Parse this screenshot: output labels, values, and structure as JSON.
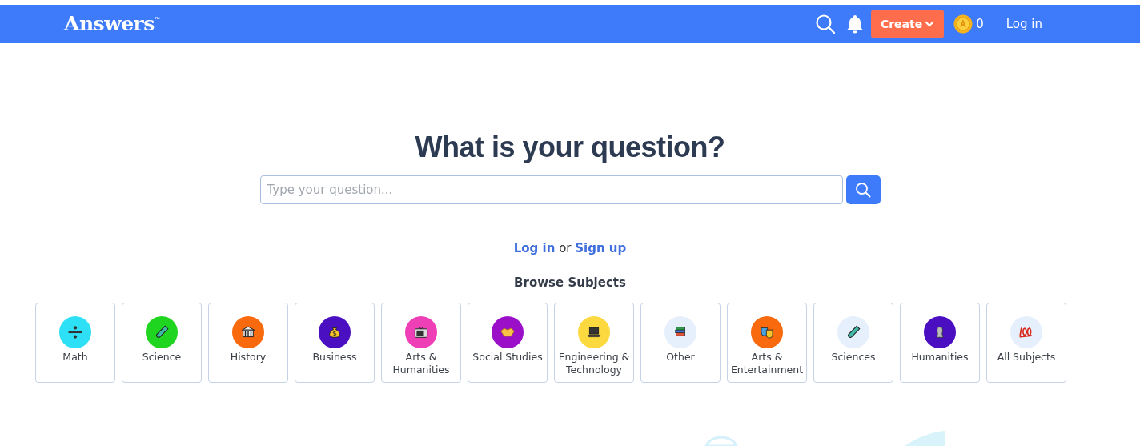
{
  "navbar": {
    "logo": "Answers",
    "logo_mark": "™",
    "create_button": "Create",
    "coins": "0",
    "login": "Log in"
  },
  "hero": {
    "title": "What is your question?",
    "search": {
      "placeholder": "Type your question..."
    }
  },
  "auth": {
    "login": "Log in",
    "or": "or",
    "signup": "Sign up"
  },
  "browse_title": "Browse Subjects",
  "subjects": [
    {
      "label": "Math",
      "color": "#2ee0f5"
    },
    {
      "label": "Science",
      "color": "#1fd51f"
    },
    {
      "label": "History",
      "color": "#f96a0e"
    },
    {
      "label": "Business",
      "color": "#4b0fc2"
    },
    {
      "label": "Arts & Humanities",
      "color": "#ee3fb6"
    },
    {
      "label": "Social Studies",
      "color": "#9b0fc9"
    },
    {
      "label": "Engineering & Technology",
      "color": "#fcd93f"
    },
    {
      "label": "Other",
      "color": "#e6effc"
    },
    {
      "label": "Arts & Entertainment",
      "color": "#f96a0e"
    },
    {
      "label": "Sciences",
      "color": "#e6effc"
    },
    {
      "label": "Humanities",
      "color": "#4b0fc2"
    },
    {
      "label": "All Subjects",
      "color": "#e6effc"
    }
  ]
}
